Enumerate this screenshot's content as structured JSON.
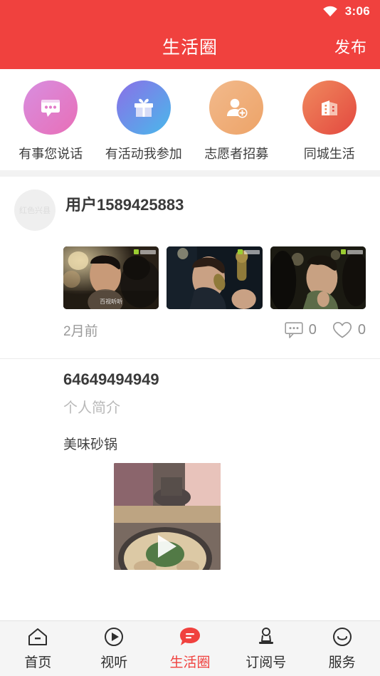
{
  "status_bar": {
    "wifi_icon": "wifi-icon",
    "time": "3:06"
  },
  "header": {
    "title": "生活圈",
    "action_label": "发布"
  },
  "colors": {
    "brand_red": "#f0413e",
    "active_tab": "#f0413e",
    "page_bg": "#ffffff",
    "divider": "#f2f2f2"
  },
  "categories": [
    {
      "label": "有事您说话",
      "icon": "speech-bubble-icon",
      "gradient": "pink-magenta"
    },
    {
      "label": "有活动我参加",
      "icon": "gift-box-icon",
      "gradient": "purple-blue"
    },
    {
      "label": "志愿者招募",
      "icon": "person-add-icon",
      "gradient": "orange-light"
    },
    {
      "label": "同城生活",
      "icon": "buildings-icon",
      "gradient": "orange-red"
    }
  ],
  "feed": [
    {
      "avatar_placeholder": "红色兴县",
      "username": "用户1589425883",
      "time": "2月前",
      "comment_icon": "comment-bubble-icon",
      "comment_count": "0",
      "like_icon": "heart-icon",
      "like_count": "0",
      "thumbnails": [
        {
          "caption": "百视听听",
          "watermark": "watermark-badge"
        },
        {
          "caption": "",
          "watermark": "watermark-badge"
        },
        {
          "caption": "",
          "watermark": "watermark-badge"
        }
      ]
    },
    {
      "username": "64649494949",
      "subtitle": "个人简介",
      "text": "美味砂锅",
      "video_icon": "play-button-icon"
    }
  ],
  "tabbar": [
    {
      "label": "首页",
      "icon": "home-icon",
      "active": false
    },
    {
      "label": "视听",
      "icon": "play-circle-icon",
      "active": false
    },
    {
      "label": "生活圈",
      "icon": "chat-bubble-filled-icon",
      "active": true
    },
    {
      "label": "订阅号",
      "icon": "subscription-stamp-icon",
      "active": false
    },
    {
      "label": "服务",
      "icon": "smiley-face-icon",
      "active": false
    }
  ]
}
